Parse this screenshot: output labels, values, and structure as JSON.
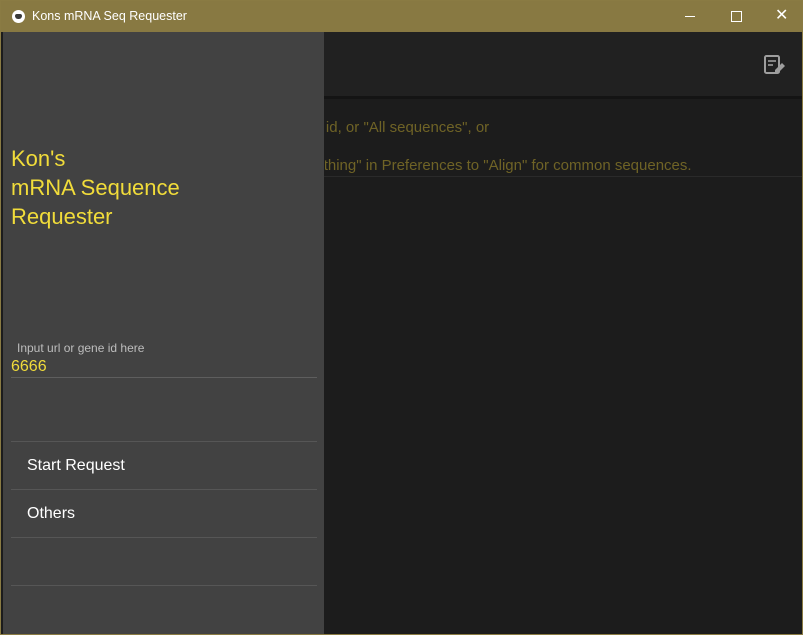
{
  "window": {
    "title": "Kons mRNA Seq Requester",
    "controls": {
      "minimize": "minimize-icon",
      "maximize": "maximize-icon",
      "close": "close-icon"
    }
  },
  "toolbar": {
    "action_icon": "edit-note-icon"
  },
  "main": {
    "line1": "Input an url, gene id, or \"All sequences\", or",
    "line2": "Switch the \"Do nothing\" in Preferences to \"Align\" for common sequences."
  },
  "drawer": {
    "title": "Kon's\nmRNA Sequence\nRequester",
    "input": {
      "placeholder": "Input url or gene id here",
      "value": "6666"
    },
    "menu_items": [
      {
        "label": "Start Request"
      },
      {
        "label": "Others"
      },
      {
        "label": ""
      }
    ]
  },
  "colors": {
    "titlebar": "#887942",
    "accent_text": "#f1dc3a",
    "drawer_bg": "#424242",
    "main_bg": "#1c1c1c",
    "dim_text": "#6f6326"
  }
}
